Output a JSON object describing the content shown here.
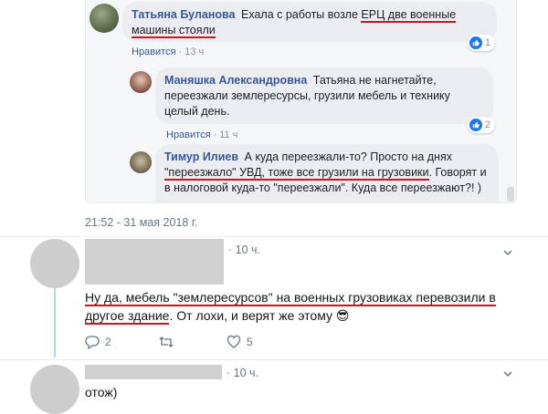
{
  "fb": {
    "comments": [
      {
        "author": "Татьяна Буланова",
        "text_before": "Ехала с работы возле ",
        "text_underlined": "ЕРЦ две военные машины стояли",
        "like_label": "Нравится",
        "time": "13 ч",
        "reaction_count": "1"
      },
      {
        "author": "Маняшка Александровна",
        "text": "Татьяна не нагнетайте, переезжали землересурсы, грузили мебель и технику целый день.",
        "like_label": "Нравится",
        "time": "11 ч",
        "reaction_count": "2"
      },
      {
        "author": "Тимур Илиев",
        "text_before": "А куда переезжали-то? Просто на днях ",
        "text_underlined": "\"переезжало\" УВД, тоже все грузили на грузовики",
        "text_after": ". Говорят и в налоговой куда-то \"переезжали\". Куда все переезжают?! )"
      }
    ]
  },
  "timestamp": "21:52 - 31 мая 2018 г.",
  "tweets": [
    {
      "time": "· 10 ч.",
      "text_underlined": "Ну да, мебель \"землересурсов\" на военных грузовиках перевозили в другое здание",
      "text_after": ". От лохи, и верят же этому ",
      "emoji": "😎",
      "reply_count": "2",
      "retweet_count": "",
      "like_count": "5"
    },
    {
      "time": "· 10 ч.",
      "text": "отож)"
    }
  ],
  "colors": {
    "fb_link": "#365899",
    "underline": "#d4121e",
    "like_blue": "#1877f2",
    "thread_line": "#a9dcf6"
  }
}
